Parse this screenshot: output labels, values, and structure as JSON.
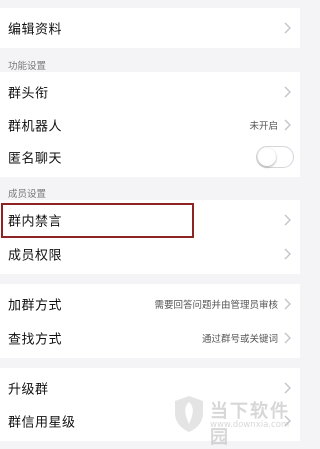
{
  "rows": {
    "edit_profile": {
      "label": "编辑资料"
    },
    "group_street": {
      "label": "群头衔"
    },
    "group_robot": {
      "label": "群机器人",
      "value": "未开启"
    },
    "anonymous_chat": {
      "label": "匿名聊天",
      "toggle_on": false
    },
    "mute_in_group": {
      "label": "群内禁言"
    },
    "member_permissions": {
      "label": "成员权限"
    },
    "join_method": {
      "label": "加群方式",
      "value": "需要回答问题并由管理员审核"
    },
    "find_method": {
      "label": "查找方式",
      "value": "通过群号或关键词"
    },
    "upgrade_group": {
      "label": "升级群"
    },
    "group_credit": {
      "label": "群信用星级"
    }
  },
  "sections": {
    "features": "功能设置",
    "members": "成员设置"
  },
  "watermark": {
    "text": "当下软件园",
    "url": "www.downxia.com"
  },
  "colors": {
    "highlight_border": "#8e2323",
    "background": "#f4f4f6"
  }
}
